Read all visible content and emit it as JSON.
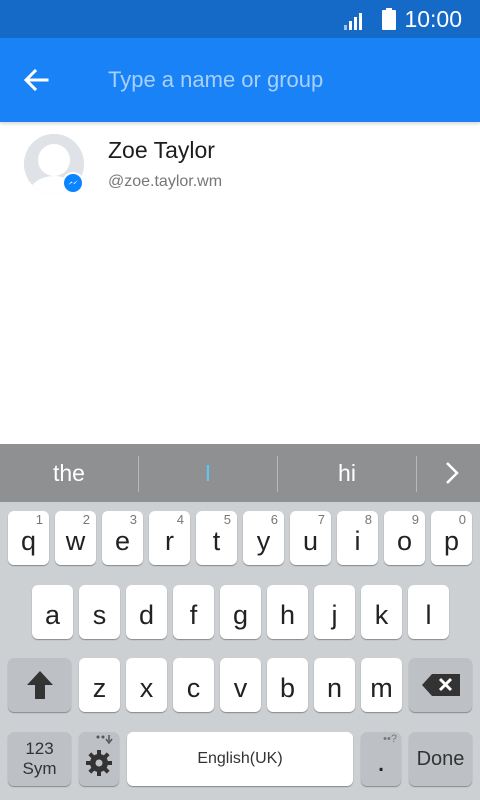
{
  "status": {
    "time": "10:00"
  },
  "header": {
    "search_placeholder": "Type a name or group"
  },
  "contact": {
    "name": "Zoe Taylor",
    "handle": "@zoe.taylor.wm"
  },
  "keyboard": {
    "suggestions": [
      "the",
      "I",
      "hi"
    ],
    "row1": [
      {
        "k": "q",
        "h": "1"
      },
      {
        "k": "w",
        "h": "2"
      },
      {
        "k": "e",
        "h": "3"
      },
      {
        "k": "r",
        "h": "4"
      },
      {
        "k": "t",
        "h": "5"
      },
      {
        "k": "y",
        "h": "6"
      },
      {
        "k": "u",
        "h": "7"
      },
      {
        "k": "i",
        "h": "8"
      },
      {
        "k": "o",
        "h": "9"
      },
      {
        "k": "p",
        "h": "0"
      }
    ],
    "row2": [
      "a",
      "s",
      "d",
      "f",
      "g",
      "h",
      "j",
      "k",
      "l"
    ],
    "row3": [
      "z",
      "x",
      "c",
      "v",
      "b",
      "n",
      "m"
    ],
    "sym_label_top": "123",
    "sym_label_bottom": "Sym",
    "space_label": "English(UK)",
    "period_hint": "••?",
    "period": ".",
    "done_label": "Done"
  },
  "colors": {
    "status_bar": "#1569c7",
    "app_bar": "#1a82f7",
    "suggestion_bar": "#8e9092",
    "cursor": "#5cc7f5"
  }
}
